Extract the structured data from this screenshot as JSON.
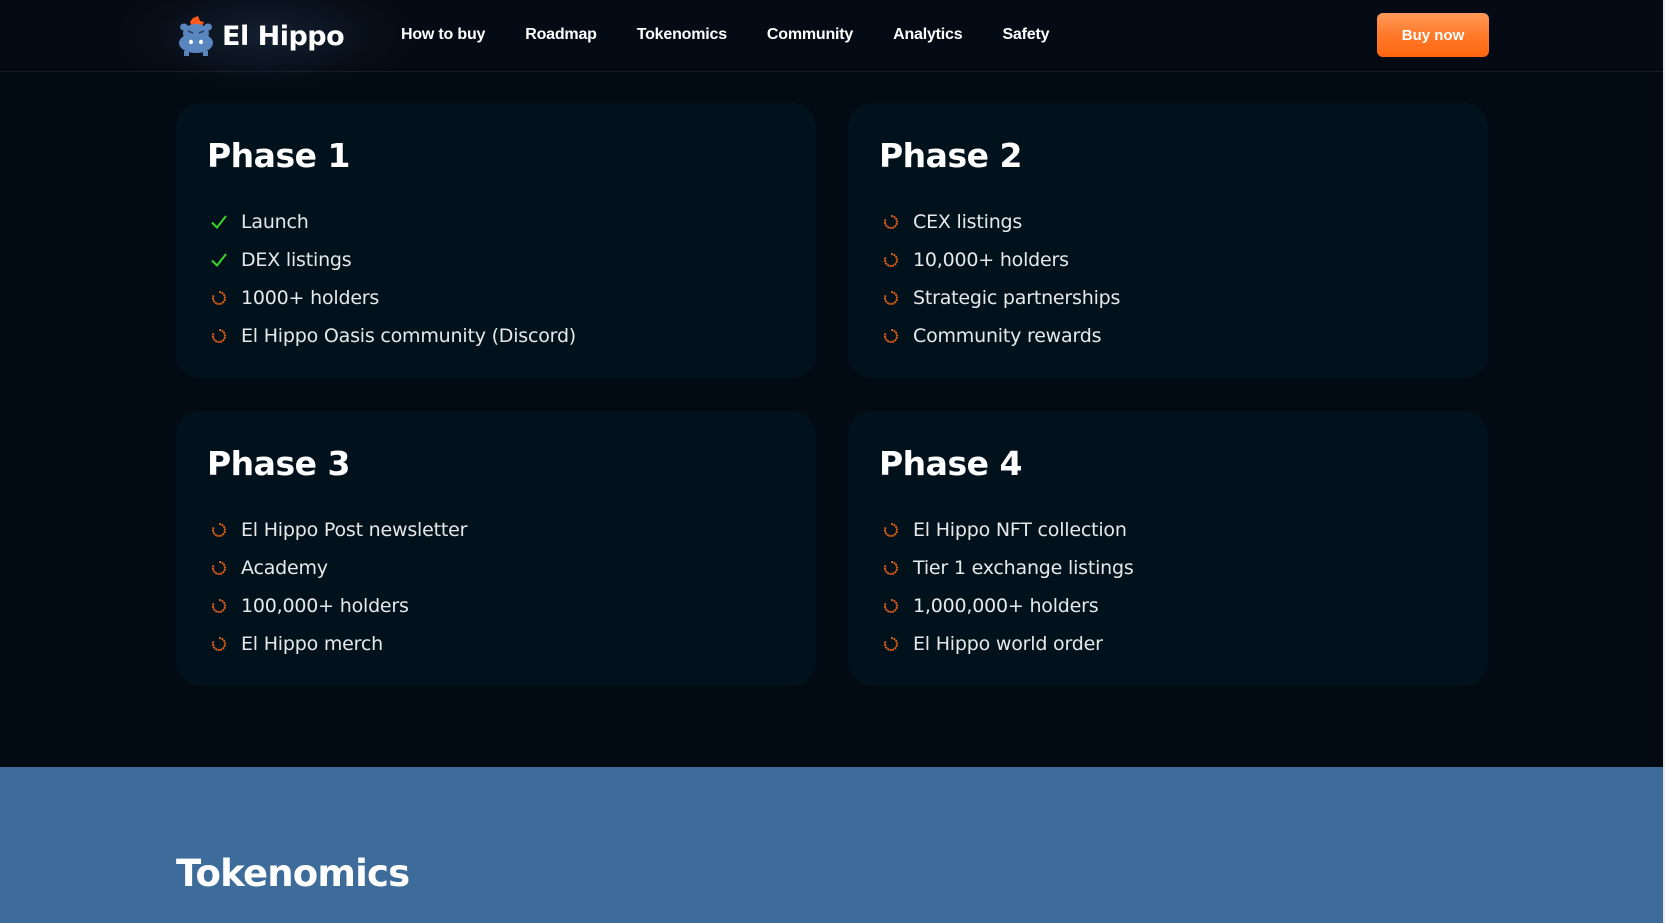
{
  "header": {
    "brand": "El Hippo",
    "logo_icon": "hippo-mascot-icon",
    "nav": [
      "How to buy",
      "Roadmap",
      "Tokenomics",
      "Community",
      "Analytics",
      "Safety"
    ],
    "cta_label": "Buy now"
  },
  "colors": {
    "accent_orange": "#ff7a2a",
    "done_green": "#39d42a",
    "pending_orange": "#e0601a",
    "card_bg": "#02121c",
    "page_bg": "#020a13",
    "section_blue": "#3d6b9a"
  },
  "roadmap": {
    "phases": [
      {
        "title": "Phase 1",
        "items": [
          {
            "label": "Launch",
            "status": "done",
            "icon": "check-icon"
          },
          {
            "label": "DEX listings",
            "status": "done",
            "icon": "check-icon"
          },
          {
            "label": "1000+ holders",
            "status": "pending",
            "icon": "spinner-icon"
          },
          {
            "label": "El Hippo Oasis community (Discord)",
            "status": "pending",
            "icon": "spinner-icon"
          }
        ]
      },
      {
        "title": "Phase 2",
        "items": [
          {
            "label": "CEX listings",
            "status": "pending",
            "icon": "spinner-icon"
          },
          {
            "label": "10,000+ holders",
            "status": "pending",
            "icon": "spinner-icon"
          },
          {
            "label": "Strategic partnerships",
            "status": "pending",
            "icon": "spinner-icon"
          },
          {
            "label": "Community rewards",
            "status": "pending",
            "icon": "spinner-icon"
          }
        ]
      },
      {
        "title": "Phase 3",
        "items": [
          {
            "label": "El Hippo Post newsletter",
            "status": "pending",
            "icon": "spinner-icon"
          },
          {
            "label": "Academy",
            "status": "pending",
            "icon": "spinner-icon"
          },
          {
            "label": "100,000+ holders",
            "status": "pending",
            "icon": "spinner-icon"
          },
          {
            "label": "El Hippo merch",
            "status": "pending",
            "icon": "spinner-icon"
          }
        ]
      },
      {
        "title": "Phase 4",
        "items": [
          {
            "label": "El Hippo NFT collection",
            "status": "pending",
            "icon": "spinner-icon"
          },
          {
            "label": "Tier 1 exchange listings",
            "status": "pending",
            "icon": "spinner-icon"
          },
          {
            "label": "1,000,000+ holders",
            "status": "pending",
            "icon": "spinner-icon"
          },
          {
            "label": "El Hippo world order",
            "status": "pending",
            "icon": "spinner-icon"
          }
        ]
      }
    ]
  },
  "tokenomics": {
    "title": "Tokenomics"
  }
}
